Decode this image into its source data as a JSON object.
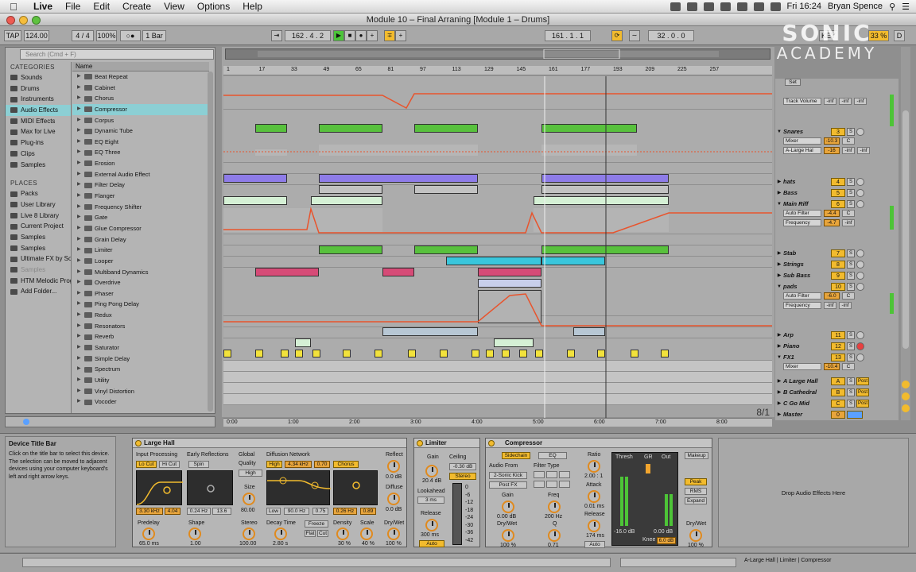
{
  "menubar": {
    "app": "Live",
    "items": [
      "File",
      "Edit",
      "Create",
      "View",
      "Options",
      "Help"
    ],
    "clock": "Fri 16:24",
    "user": "Bryan Spence"
  },
  "window": {
    "title": "Module 10 – Final Arraning  [Module 1 – Drums]"
  },
  "control": {
    "tap": "TAP",
    "tempo": "124.00",
    "time_sig": "4 / 4",
    "zoom": "100%",
    "quantize": "1 Bar",
    "position": "162 .  4 .  2",
    "loop_start": "161 .  1 .  1",
    "loop_len": "32 .  0 .  0",
    "key": "KEY",
    "cpu": "33 %",
    "d": "D"
  },
  "watermark": {
    "line1": "SONIC",
    "line2": "ACADEMY"
  },
  "browser": {
    "search_placeholder": "Search (Cmd + F)",
    "categories_title": "CATEGORIES",
    "categories": [
      "Sounds",
      "Drums",
      "Instruments",
      "Audio Effects",
      "MIDI Effects",
      "Max for Live",
      "Plug-ins",
      "Clips",
      "Samples"
    ],
    "selected_category": "Audio Effects",
    "places_title": "PLACES",
    "places": [
      "Packs",
      "User Library",
      "Live 8 Library",
      "Current Project",
      "Samples",
      "Samples",
      "Ultimate FX by So",
      "Samples",
      "HTM Melodic Prog",
      "Add Folder..."
    ],
    "name_header": "Name",
    "devices": [
      "Beat Repeat",
      "Cabinet",
      "Chorus",
      "Compressor",
      "Corpus",
      "Dynamic Tube",
      "EQ Eight",
      "EQ Three",
      "Erosion",
      "External Audio Effect",
      "Filter Delay",
      "Flanger",
      "Frequency Shifter",
      "Gate",
      "Glue Compressor",
      "Grain Delay",
      "Limiter",
      "Looper",
      "Multiband Dynamics",
      "Overdrive",
      "Phaser",
      "Ping Pong Delay",
      "Redux",
      "Resonators",
      "Reverb",
      "Saturator",
      "Simple Delay",
      "Spectrum",
      "Utility",
      "Vinyl Distortion",
      "Vocoder"
    ],
    "selected_device": "Compressor"
  },
  "ruler": {
    "bars": [
      "1",
      "17",
      "33",
      "49",
      "65",
      "81",
      "97",
      "113",
      "129",
      "145",
      "161",
      "177",
      "193",
      "209",
      "225",
      "257"
    ],
    "times": [
      "0:00",
      "1:00",
      "2:00",
      "3:00",
      "4:00",
      "5:00",
      "6:00",
      "7:00",
      "8:00"
    ],
    "zoom_label": "8/1"
  },
  "mixer": {
    "set_label": "Set",
    "tracks": [
      {
        "name": "Snares",
        "num": "3"
      },
      {
        "name": "hats",
        "num": "4"
      },
      {
        "name": "Bass",
        "num": "5"
      },
      {
        "name": "Main Riff",
        "num": "6"
      },
      {
        "name": "Stab",
        "num": "7"
      },
      {
        "name": "Strings",
        "num": "8"
      },
      {
        "name": "Sub Bass",
        "num": "9"
      },
      {
        "name": "pads",
        "num": "10"
      },
      {
        "name": "Arp",
        "num": "11"
      },
      {
        "name": "Piano",
        "num": "12"
      },
      {
        "name": "FX1",
        "num": "13"
      },
      {
        "name": "A Large Hall",
        "num": "A"
      },
      {
        "name": "B Cathedral",
        "num": "B"
      },
      {
        "name": "C Go Mid",
        "num": "C"
      },
      {
        "name": "Master",
        "num": "0"
      }
    ],
    "sub_rows": {
      "track_volume": "Track Volume",
      "mixer": "Mixer",
      "a_large_hall": "A-Large Hal",
      "auto_filter": "Auto Filter",
      "frequency": "Frequency",
      "snares_vol": "-10.3",
      "snares_send": "-16",
      "mainriff_val": "-4.4",
      "mainriff_freq": "-4.7",
      "pads_val": "-6.0",
      "fx1_val": "-10.4",
      "inf": "-inf",
      "center": "C",
      "post": "Post"
    }
  },
  "info": {
    "title": "Device Title Bar",
    "text": "Click on the title bar to select this device. The selection can be moved to adjacent devices using your computer keyboard's left and right arrow keys."
  },
  "devices": {
    "reverb": {
      "name": "Large Hall",
      "input_processing": "Input Processing",
      "lo_cut": "Lo Cut",
      "hi_cut": "Hi Cut",
      "early_reflections": "Early Reflections",
      "spin": "Spin",
      "global": "Global",
      "quality": "Quality",
      "quality_val": "High",
      "size": "Size",
      "size_val": "80.00",
      "diffusion_network": "Diffusion Network",
      "high": "High",
      "freq_val": "4.34 kHz",
      "rate_val": "0.70",
      "chorus": "Chorus",
      "reflect": "Reflect",
      "reflect_val": "0.0 dB",
      "diffuse": "Diffuse",
      "diffuse_val": "0.0 dB",
      "lo_freq": "3.30 kHz",
      "lo_val": "4.04",
      "er_val1": "0.24 Hz",
      "er_val2": "13.6",
      "low": "Low",
      "dn_low": "90.0 Hz",
      "dn_val": "0.75",
      "ch_rate": "0.26 Hz",
      "ch_amt": "0.89",
      "predelay": "Predelay",
      "predelay_val": "65.0 ms",
      "shape": "Shape",
      "shape_val": "1.00",
      "stereo": "Stereo",
      "stereo_val": "100.00",
      "decay": "Decay Time",
      "decay_val": "2.80 s",
      "freeze": "Freeze",
      "flat": "Flat",
      "cut": "Cut",
      "density": "Density",
      "density_val": "30 %",
      "scale": "Scale",
      "scale_val": "40 %",
      "drywet": "Dry/Wet",
      "drywet_val": "100 %"
    },
    "limiter": {
      "name": "Limiter",
      "gain": "Gain",
      "gain_val": "20.4 dB",
      "ceiling": "Ceiling",
      "ceiling_val": "-0.30 dB",
      "stereo": "Stereo",
      "lookahead": "Lookahead",
      "lookahead_val": "3 ms",
      "release": "Release",
      "release_val": "300 ms",
      "auto": "Auto",
      "scale": [
        "0",
        "-6",
        "-12",
        "-18",
        "-24",
        "-30",
        "-36",
        "-42"
      ]
    },
    "compressor": {
      "name": "Compressor",
      "sidechain": "Sidechain",
      "eq": "EQ",
      "audio_from": "Audio From",
      "source": "2-Sonic Kick",
      "post_fx": "Post FX",
      "filter_type": "Filter Type",
      "gain": "Gain",
      "gain_val": "0.00 dB",
      "freq": "Freq",
      "freq_val": "200 Hz",
      "q": "Q",
      "q_val": "0.71",
      "drywet": "Dry/Wet",
      "drywet_val": "100 %",
      "ratio": "Ratio",
      "ratio_val": "2.00 : 1",
      "attack": "Attack",
      "attack_val": "0.01 ms",
      "release": "Release",
      "release_val": "174 ms",
      "auto": "Auto",
      "thresh": "Thresh",
      "gr": "GR",
      "out": "Out",
      "thresh_val": "-16.0 dB",
      "out_val": "0.00 dB",
      "knee": "Knee",
      "knee_val": "6.0 dB",
      "makeup": "Makeup",
      "peak": "Peak",
      "rms": "RMS",
      "expand": "Expand",
      "drywet2_val": "100 %"
    },
    "drop_hint": "Drop Audio Effects Here"
  },
  "status": {
    "chain": "A-Large Hall | Limiter | Compressor"
  }
}
